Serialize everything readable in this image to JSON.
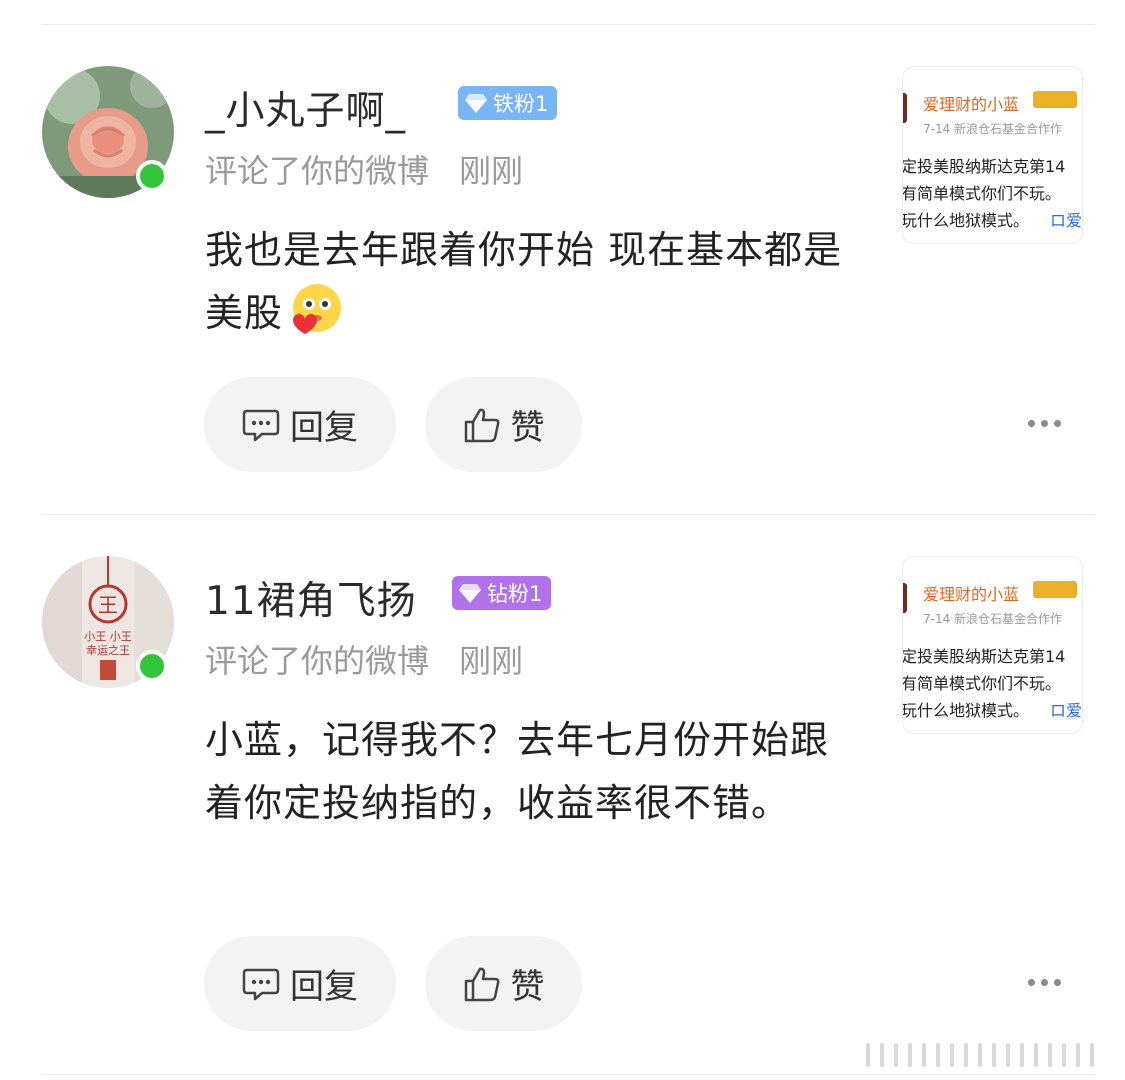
{
  "comments": [
    {
      "username": "_小丸子啊_",
      "badge": {
        "label": "铁粉1",
        "color": "#79b4f5"
      },
      "meta_action": "评论了你的微博",
      "meta_time": "刚刚",
      "content": "我也是去年跟着你开始 现在基本都是美股",
      "emoji": "face-hearts-emoji",
      "reply_label": "回复",
      "like_label": "赞",
      "thumb": {
        "name": "爱理财的小蓝",
        "sub": "7-14  新浪仓石基金合作作",
        "lines": [
          "定投美股纳斯达克第14",
          "有简单模式你们不玩。",
          "玩什么地狱模式。"
        ],
        "link": "ロ爱"
      }
    },
    {
      "username": "11裙角飞扬",
      "badge": {
        "label": "钻粉1",
        "color": "#b071ea"
      },
      "meta_action": "评论了你的微博",
      "meta_time": "刚刚",
      "content": "小蓝，记得我不？去年七月份开始跟着你定投纳指的，收益率很不错。",
      "reply_label": "回复",
      "like_label": "赞",
      "thumb": {
        "name": "爱理财的小蓝",
        "sub": "7-14  新浪仓石基金合作作",
        "lines": [
          "定投美股纳斯达克第14",
          "有简单模式你们不玩。",
          "玩什么地狱模式。"
        ],
        "link": "ロ爱"
      }
    }
  ],
  "colors": {
    "online": "#32c53c",
    "pill_bg": "#f3f3f3",
    "meta": "#9a9a9a"
  }
}
